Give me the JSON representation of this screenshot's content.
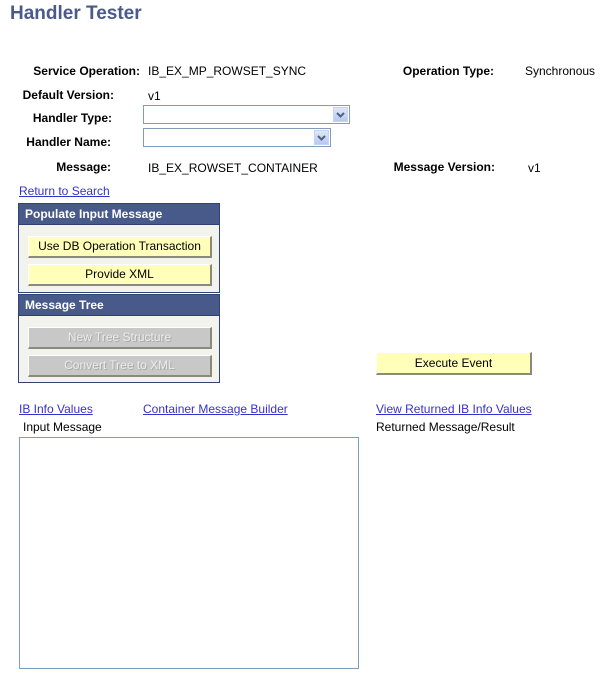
{
  "page": {
    "title": "Handler Tester"
  },
  "fields": {
    "service_operation": {
      "label": "Service Operation:",
      "value": "IB_EX_MP_ROWSET_SYNC"
    },
    "operation_type": {
      "label": "Operation Type:",
      "value": "Synchronous"
    },
    "default_version": {
      "label": "Default Version:",
      "value": "v1"
    },
    "handler_type": {
      "label": "Handler Type:",
      "value": ""
    },
    "handler_name": {
      "label": "Handler Name:",
      "value": ""
    },
    "message": {
      "label": "Message:",
      "value": "IB_EX_ROWSET_CONTAINER"
    },
    "message_version": {
      "label": "Message Version:",
      "value": "v1"
    }
  },
  "links": {
    "return_to_search": "Return to Search",
    "ib_info_values": "IB Info Values",
    "container_message_builder": "Container Message Builder",
    "view_returned_ib_info_values": "View Returned IB Info Values"
  },
  "populate_group": {
    "header": "Populate Input Message",
    "buttons": [
      "Use DB Operation Transaction",
      "Provide XML"
    ]
  },
  "tree_group": {
    "header": "Message Tree",
    "buttons": [
      "New Tree Structure",
      "Convert Tree to XML"
    ]
  },
  "execute_button": "Execute Event",
  "input_message": {
    "label": "Input Message",
    "value": ""
  },
  "returned_message": {
    "label": "Returned Message/Result"
  },
  "colors": {
    "title": "#4a5a8c",
    "group_header": "#475a8a",
    "button": "#ffffb9",
    "link": "#3333cc"
  }
}
